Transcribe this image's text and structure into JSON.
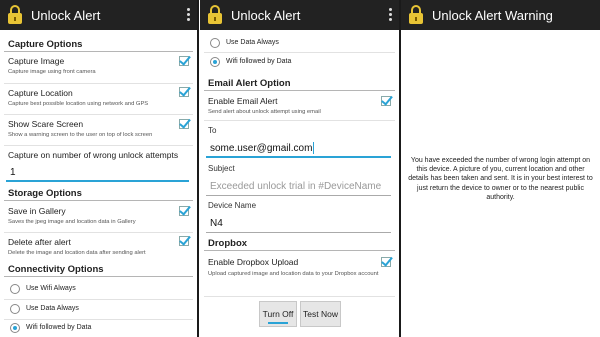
{
  "panel1": {
    "title": "Unlock Alert",
    "capture_options_header": "Capture Options",
    "capture_image": {
      "title": "Capture Image",
      "summary": "Capture image using front camera",
      "checked": true
    },
    "capture_location": {
      "title": "Capture Location",
      "summary": "Capture best possible location using network and GPS",
      "checked": true
    },
    "show_scare_screen": {
      "title": "Show Scare Screen",
      "summary": "Show a warning screen to the user on top of lock screen",
      "checked": true
    },
    "wrong_attempts_label": "Capture on number of wrong unlock attempts",
    "wrong_attempts_value": "1",
    "storage_options_header": "Storage Options",
    "save_in_gallery": {
      "title": "Save in Gallery",
      "summary": "Saves the jpeg image and location data in Gallery",
      "checked": true
    },
    "delete_after_alert": {
      "title": "Delete after alert",
      "summary": "Delete the image and location data after sending alert",
      "checked": true
    },
    "connectivity_options_header": "Connectivity Options",
    "connectivity": [
      {
        "label": "Use Wifi Always",
        "selected": false
      },
      {
        "label": "Use Data Always",
        "selected": false
      },
      {
        "label": "Wifi followed by Data",
        "selected": true
      }
    ]
  },
  "panel2": {
    "title": "Unlock Alert",
    "connectivity": [
      {
        "label": "Use Data Always",
        "selected": false
      },
      {
        "label": "Wifi followed by Data",
        "selected": true
      }
    ],
    "email_alert_header": "Email Alert Option",
    "enable_email_alert": {
      "title": "Enable Email Alert",
      "summary": "Send alert about unlock attempt using email",
      "checked": true
    },
    "to_label": "To",
    "to_value": "some.user@gmail.com",
    "subject_label": "Subject",
    "subject_placeholder": "Exceeded unlock trial in #DeviceName",
    "device_name_label": "Device Name",
    "device_name_value": "N4",
    "dropbox_header": "Dropbox",
    "enable_dropbox_upload": {
      "title": "Enable Dropbox Upload",
      "summary": "Upload captured image and location data to your Dropbox account",
      "checked": true
    },
    "turn_off_button": "Turn Off",
    "test_now_button": "Test Now"
  },
  "panel3": {
    "title": "Unlock Alert Warning",
    "warning_text": "You have exceeded the number of wrong login attempt on this device. A picture of you, current location and other details has been taken and sent. It is in your best interest to just return the device to owner or to the nearest public authority."
  },
  "colors": {
    "action_bar": "#222222",
    "accent": "#2aa3d6",
    "lock_icon": "#e8c435"
  }
}
